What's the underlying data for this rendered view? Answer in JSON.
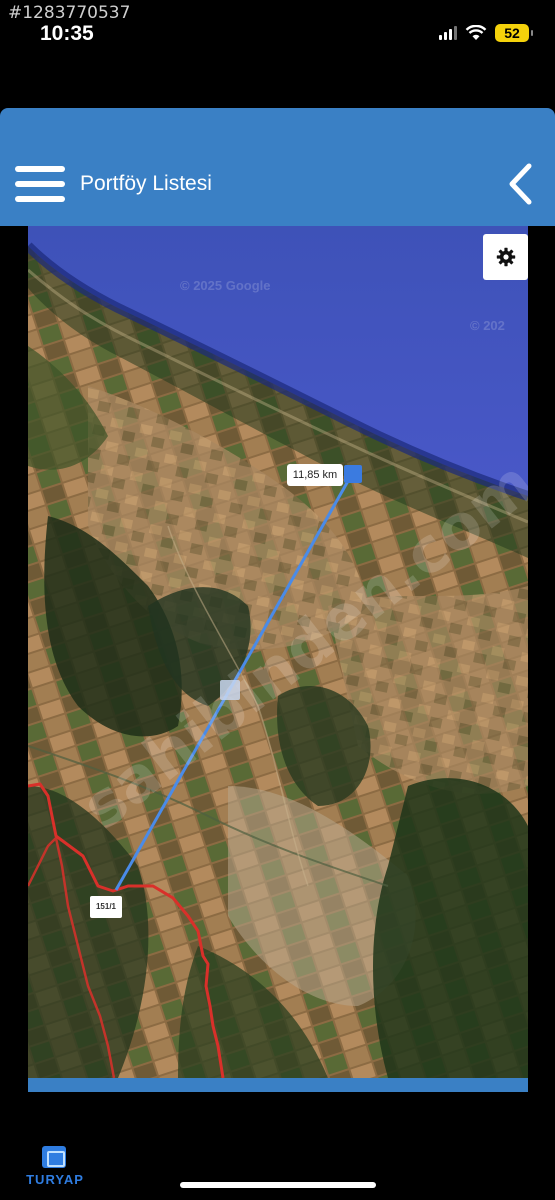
{
  "status_bar": {
    "listing_id": "#1283770537",
    "time": "10:35",
    "battery": "52",
    "icons": [
      "signal-icon",
      "wifi-icon",
      "battery-icon"
    ]
  },
  "header": {
    "title": "Portföy Listesi",
    "menu_icon": "hamburger-menu-icon",
    "back_icon": "chevron-left-icon",
    "background_color": "#3a80c5"
  },
  "map": {
    "type": "satellite",
    "copyright_texts": [
      "© 2025 Google",
      "© 202"
    ],
    "distance_label": "11,85 km",
    "parcel_label": "151/1",
    "settings_icon": "gear-icon",
    "line_color": "#4a8be8",
    "boundary_color": "#d9302a",
    "watermark": "sahibinden.com"
  },
  "footer": {
    "brand_name": "TURYAP"
  }
}
